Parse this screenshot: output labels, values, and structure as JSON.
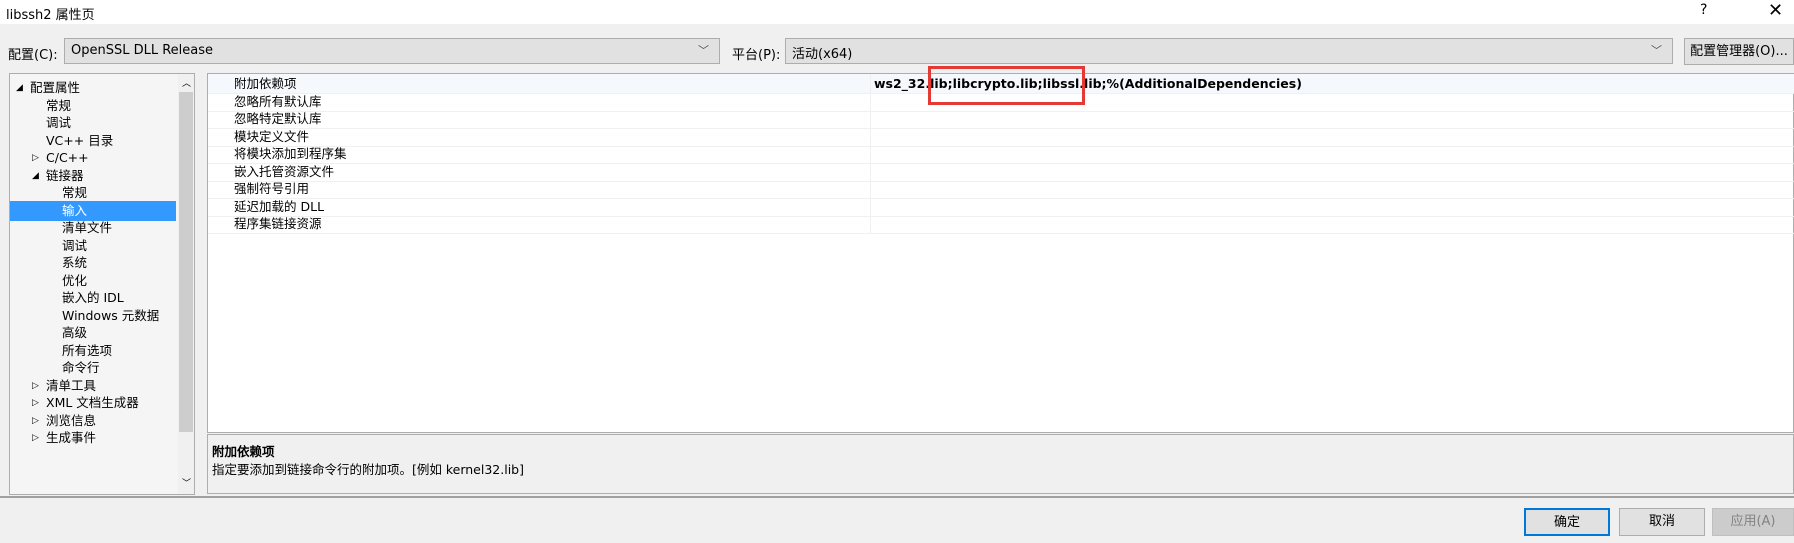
{
  "window": {
    "title": "libssh2 属性页",
    "help": "?",
    "close": "✕"
  },
  "config": {
    "label": "配置(C):",
    "value": "OpenSSL DLL Release"
  },
  "platform": {
    "label": "平台(P):",
    "value": "活动(x64)"
  },
  "config_manager": "配置管理器(O)...",
  "tree": [
    {
      "label": "配置属性",
      "level": 0,
      "expander": "expanded"
    },
    {
      "label": "常规",
      "level": 1
    },
    {
      "label": "调试",
      "level": 1
    },
    {
      "label": "VC++ 目录",
      "level": 1
    },
    {
      "label": "C/C++",
      "level": 1,
      "expander": "collapsed"
    },
    {
      "label": "链接器",
      "level": 1,
      "expander": "expanded"
    },
    {
      "label": "常规",
      "level": 2
    },
    {
      "label": "输入",
      "level": 2,
      "selected": true
    },
    {
      "label": "清单文件",
      "level": 2
    },
    {
      "label": "调试",
      "level": 2
    },
    {
      "label": "系统",
      "level": 2
    },
    {
      "label": "优化",
      "level": 2
    },
    {
      "label": "嵌入的 IDL",
      "level": 2
    },
    {
      "label": "Windows 元数据",
      "level": 2
    },
    {
      "label": "高级",
      "level": 2
    },
    {
      "label": "所有选项",
      "level": 2
    },
    {
      "label": "命令行",
      "level": 2
    },
    {
      "label": "清单工具",
      "level": 1,
      "expander": "collapsed"
    },
    {
      "label": "XML 文档生成器",
      "level": 1,
      "expander": "collapsed"
    },
    {
      "label": "浏览信息",
      "level": 1,
      "expander": "collapsed"
    },
    {
      "label": "生成事件",
      "level": 1,
      "expander": "collapsed"
    }
  ],
  "properties": [
    {
      "name": "附加依赖项",
      "value": "ws2_32.lib;libcrypto.lib;libssl.lib;%(AdditionalDependencies)"
    },
    {
      "name": "忽略所有默认库",
      "value": ""
    },
    {
      "name": "忽略特定默认库",
      "value": ""
    },
    {
      "name": "模块定义文件",
      "value": ""
    },
    {
      "name": "将模块添加到程序集",
      "value": ""
    },
    {
      "name": "嵌入托管资源文件",
      "value": ""
    },
    {
      "name": "强制符号引用",
      "value": ""
    },
    {
      "name": "延迟加载的 DLL",
      "value": ""
    },
    {
      "name": "程序集链接资源",
      "value": ""
    }
  ],
  "description": {
    "title": "附加依赖项",
    "text": "指定要添加到链接命令行的附加项。[例如 kernel32.lib]"
  },
  "buttons": {
    "ok": "确定",
    "cancel": "取消",
    "apply": "应用(A)"
  },
  "colors": {
    "selection": "#3399ff",
    "highlight_box": "#e53935",
    "default_button_border": "#0078d7"
  }
}
